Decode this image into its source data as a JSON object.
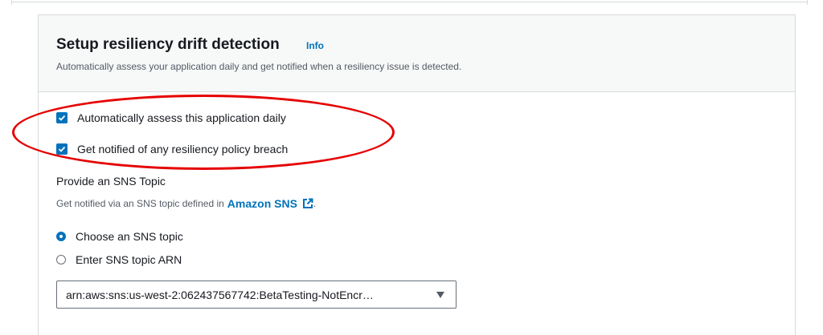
{
  "section": {
    "title": "Setup resiliency drift detection",
    "info_label": "Info",
    "subtitle": "Automatically assess your application daily and get notified when a resiliency issue is detected."
  },
  "options": {
    "auto_assess": {
      "label": "Automatically assess this application daily",
      "checked": true
    },
    "notify": {
      "label": "Get notified of any resiliency policy breach",
      "checked": true
    }
  },
  "sns": {
    "label": "Provide an SNS Topic",
    "description_prefix": "Get notified via an SNS topic defined in",
    "link_text": "Amazon SNS",
    "description_suffix": ".",
    "radios": [
      {
        "label": "Choose an SNS topic",
        "checked": true
      },
      {
        "label": "Enter SNS topic ARN",
        "checked": false
      }
    ],
    "selected_topic": "arn:aws:sns:us-west-2:062437567742:BetaTesting-NotEncr…"
  },
  "colors": {
    "accent": "#0073bb",
    "highlight": "#e60000",
    "header_bg": "#f7f8f8",
    "border": "#d5dbdb"
  }
}
